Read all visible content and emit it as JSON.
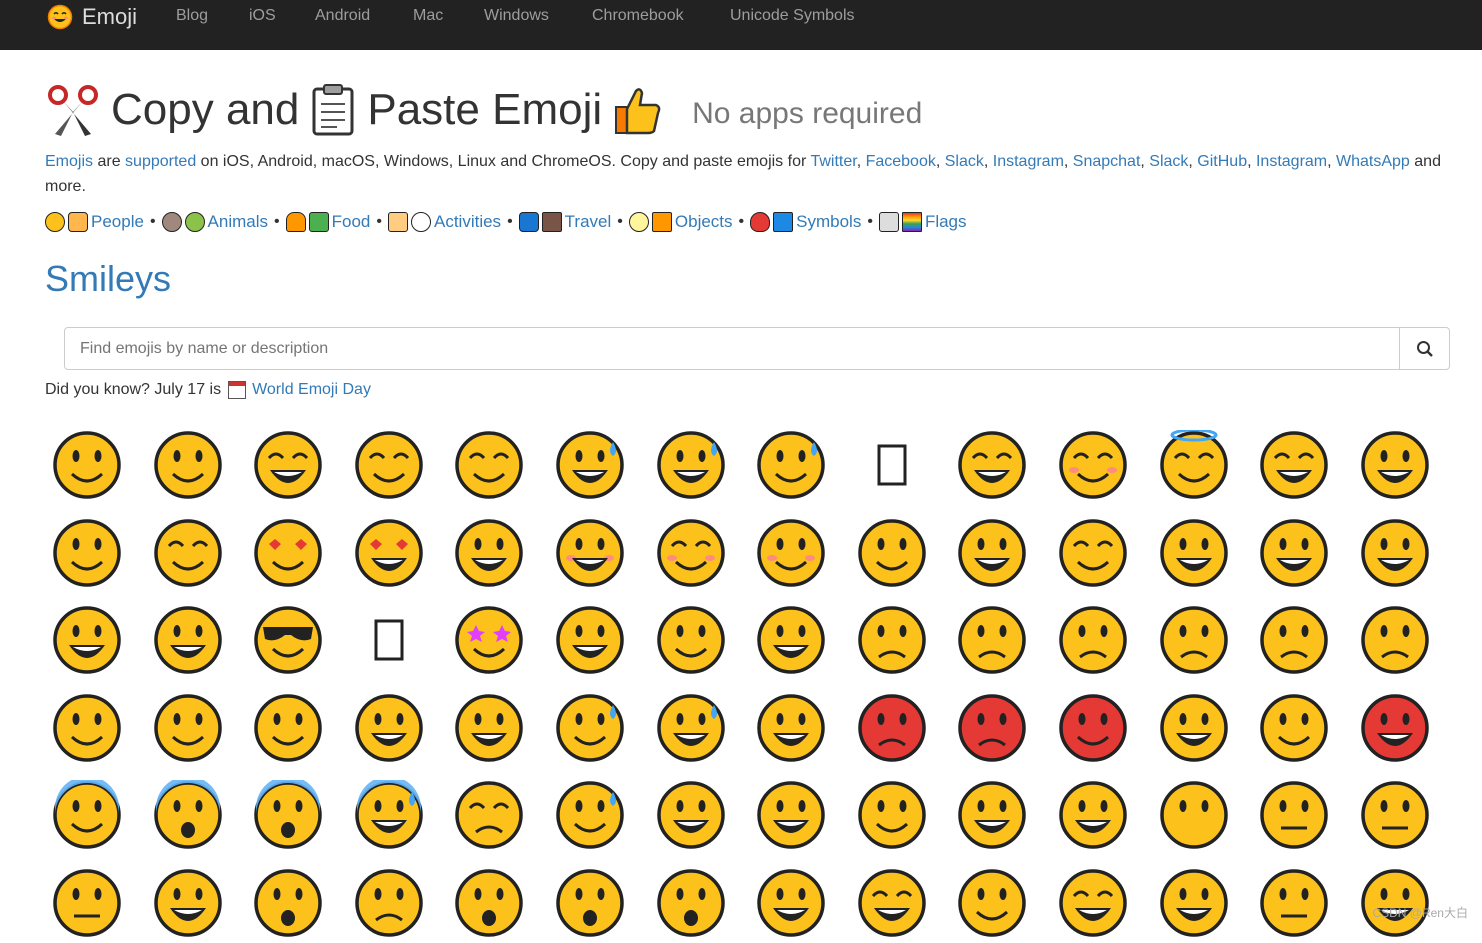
{
  "nav": {
    "brand": "Emoji",
    "links": [
      "Blog",
      "iOS",
      "Android",
      "Mac",
      "Windows",
      "Chromebook",
      "Unicode Symbols"
    ]
  },
  "headline": {
    "part1": "Copy and",
    "part2": "Paste Emoji",
    "tagline": "No apps required"
  },
  "intro": {
    "emojis_link": "Emojis",
    "are": "are",
    "supported_link": "supported",
    "text1": "on iOS, Android, macOS, Windows, Linux and ChromeOS. Copy and paste emojis for",
    "platforms": [
      "Twitter",
      "Facebook",
      "Slack",
      "Instagram",
      "Snapchat",
      "Slack",
      "GitHub",
      "Instagram",
      "WhatsApp"
    ],
    "text2": "and more."
  },
  "categories": [
    "People",
    "Animals",
    "Food",
    "Activities",
    "Travel",
    "Objects",
    "Symbols",
    "Flags"
  ],
  "section_title": "Smileys",
  "search": {
    "placeholder": "Find emojis by name or description"
  },
  "did_you_know": {
    "prefix": "Did you know? July 17 is",
    "link": "World Emoji Day"
  },
  "watermark": "CSDN @Ren大白",
  "colors": {
    "navbar": "#222222",
    "link": "#337ab7",
    "emoji_face": "#fcc21b"
  },
  "emoji_rows": [
    [
      "grinning-face",
      "grinning-face-big-eyes",
      "grinning-face-smiling-eyes",
      "beaming-face",
      "grinning-squinting-face",
      "grinning-face-sweat",
      "tears-of-joy",
      "rolling-laughing",
      "missing-glyph",
      "smiling-face-smiling-eyes",
      "smiling-blush",
      "smiling-halo",
      "slightly-smiling",
      "upside-down"
    ],
    [
      "winking-face",
      "relieved-face",
      "heart-eyes",
      "smiling-hearts",
      "face-blowing-kiss",
      "kissing-face",
      "kissing-smiling-eyes",
      "kissing-closed-eyes",
      "face-savoring-food",
      "face-with-tongue",
      "squinting-tongue",
      "winking-tongue",
      "zany-face",
      "raised-eyebrow"
    ],
    [
      "monocle-face",
      "nerd-face",
      "sunglasses-face",
      "missing-glyph",
      "star-struck",
      "partying-face",
      "smirking-face",
      "unamused-face",
      "disappointed-face",
      "pensive-face",
      "worried-face",
      "confused-face",
      "slightly-frowning",
      "frowning-face"
    ],
    [
      "persevering-face",
      "confounded-face",
      "tired-face",
      "weary-face",
      "pleading-face",
      "crying-face",
      "loudly-crying",
      "triumph-face",
      "angry-face",
      "pouting-face",
      "symbols-on-mouth",
      "exploding-head",
      "flushed-face",
      "hot-face"
    ],
    [
      "cold-face",
      "screaming-face",
      "fearful-face",
      "anxious-sweat",
      "sad-relieved",
      "downcast-sweat",
      "hugging-face",
      "thinking-face",
      "hand-over-mouth",
      "shushing-face",
      "lying-face",
      "no-mouth",
      "neutral-face",
      "expressionless"
    ],
    [
      "grimacing-face",
      "rolling-eyes",
      "hushed-face",
      "frowning-open-mouth",
      "anguished-face",
      "open-mouth",
      "astonished-face",
      "yawning-face",
      "sleeping-face",
      "drooling-face",
      "sleepy-face",
      "dizzy-face",
      "zipper-mouth",
      "woozy-face"
    ]
  ]
}
